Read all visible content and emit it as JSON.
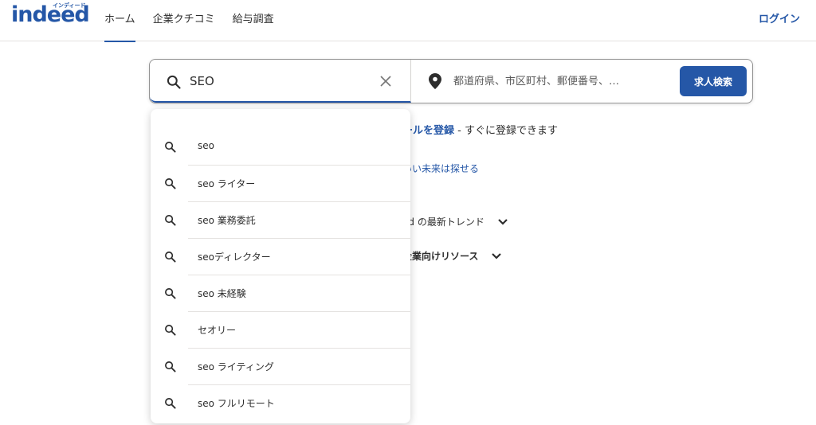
{
  "header": {
    "logo_text": "indeed",
    "logo_sub": "インディード",
    "nav": [
      {
        "label": "ホーム",
        "active": true
      },
      {
        "label": "企業クチコミ",
        "active": false
      },
      {
        "label": "給与調査",
        "active": false
      }
    ],
    "login_label": "ログイン"
  },
  "search": {
    "what_value": "SEO",
    "where_placeholder": "都道府県、市区町村、郵便番号、…",
    "button_label": "求人検索"
  },
  "background": {
    "alert_link": "ールを登録",
    "alert_text": " - すぐに登録できます",
    "future_link": "いい未来は探せる",
    "trends_label": "ed の最新トレンド",
    "employer_label": "企業向けリソース"
  },
  "suggestions": [
    {
      "label": "seo"
    },
    {
      "label": "seo ライター"
    },
    {
      "label": "seo 業務委託"
    },
    {
      "label": "seoディレクター"
    },
    {
      "label": "seo 未経験"
    },
    {
      "label": "セオリー"
    },
    {
      "label": "seo ライティング"
    },
    {
      "label": "seo フルリモート"
    }
  ],
  "colors": {
    "brand": "#2557a7",
    "text": "#2d2d2d"
  }
}
